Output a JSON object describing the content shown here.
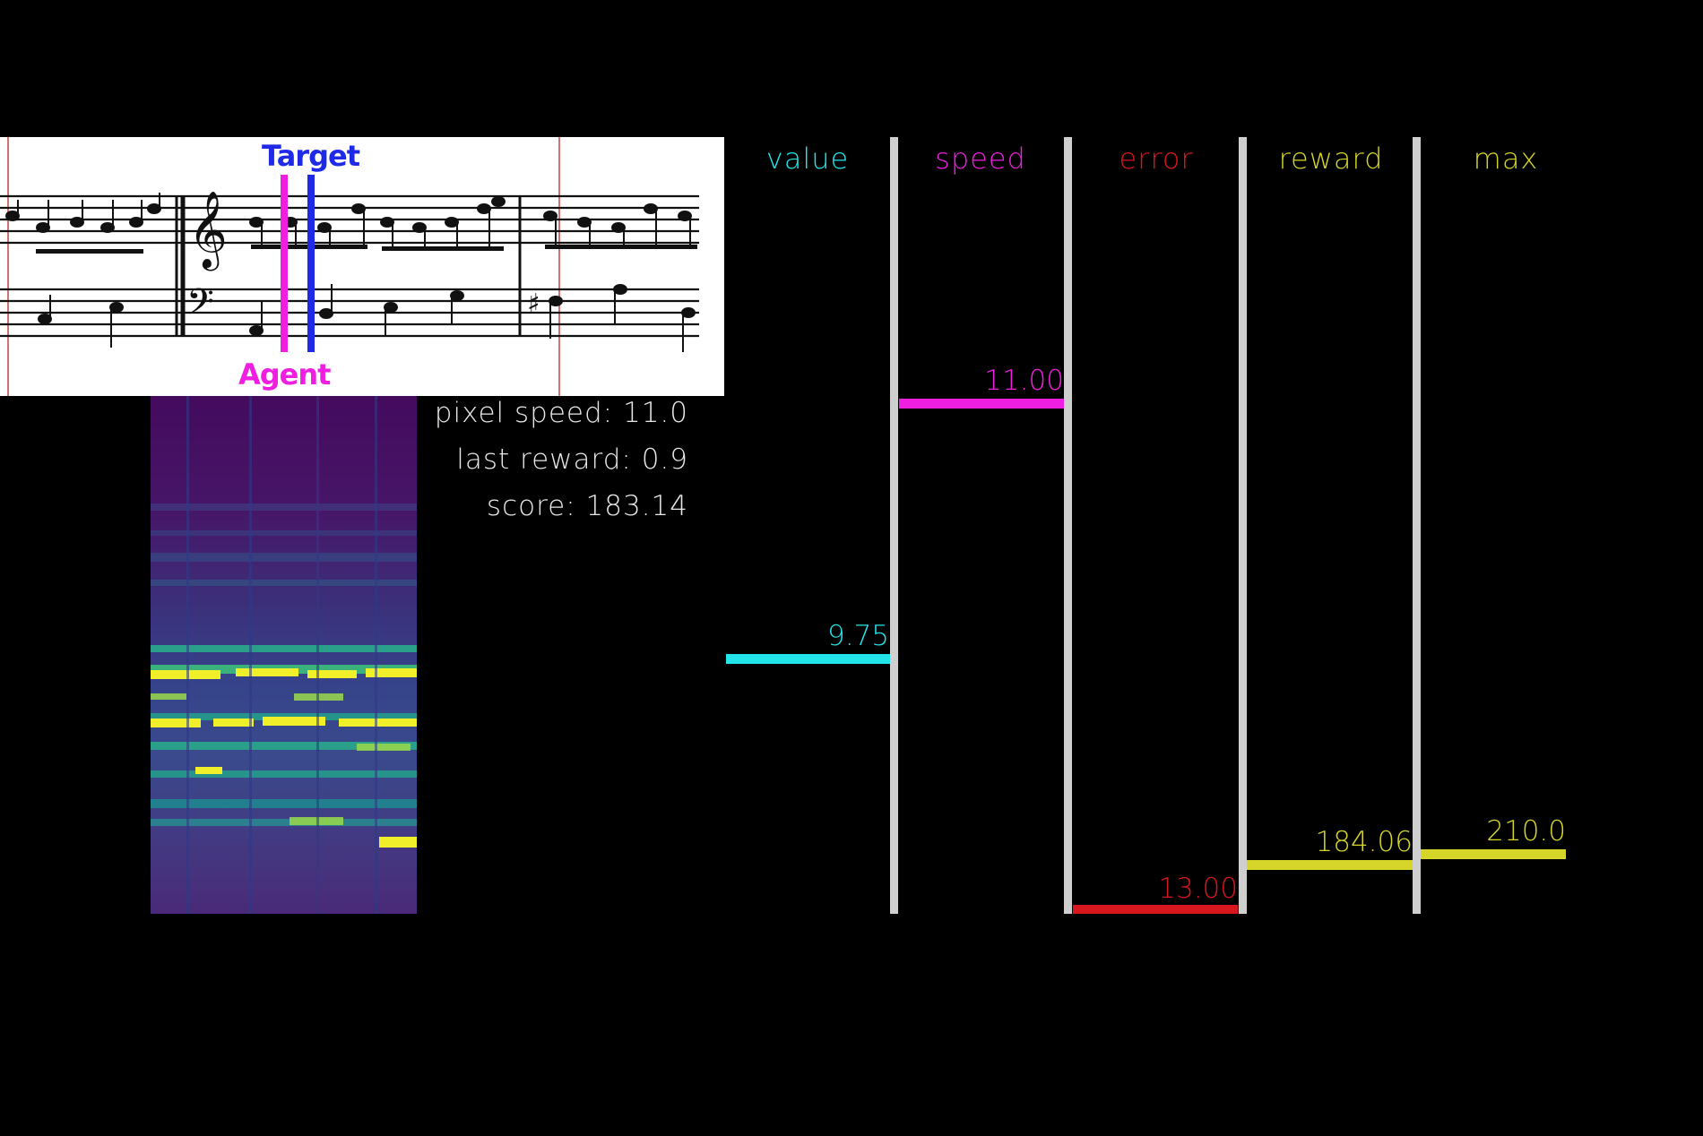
{
  "score": {
    "target_label": "Target",
    "agent_label": "Agent",
    "target_color": "#1e2ae6",
    "agent_color": "#ee1fe0"
  },
  "info": {
    "pixel_speed": "pixel speed: 11.0",
    "last_reward": "last reward: 0.9",
    "score": "score: 183.14"
  },
  "metrics": [
    {
      "key": "value",
      "label": "value",
      "value": "9.75",
      "color": "#22e4ea"
    },
    {
      "key": "speed",
      "label": "speed",
      "value": "11.00",
      "color": "#ee1fe0"
    },
    {
      "key": "error",
      "label": "error",
      "value": "13.00",
      "color": "#d8161d"
    },
    {
      "key": "reward",
      "label": "reward",
      "value": "184.06",
      "color": "#d6d62a"
    },
    {
      "key": "max",
      "label": "max",
      "value": "210.0",
      "color": "#d6d62a"
    }
  ],
  "colors": {
    "background": "#000000",
    "divider": "#cfcfcf",
    "info_text": "#e8e8e8",
    "spectrogram_low": "#440a5e",
    "spectrogram_mid": "#2b7f8e",
    "spectrogram_high": "#f1ef2a"
  }
}
